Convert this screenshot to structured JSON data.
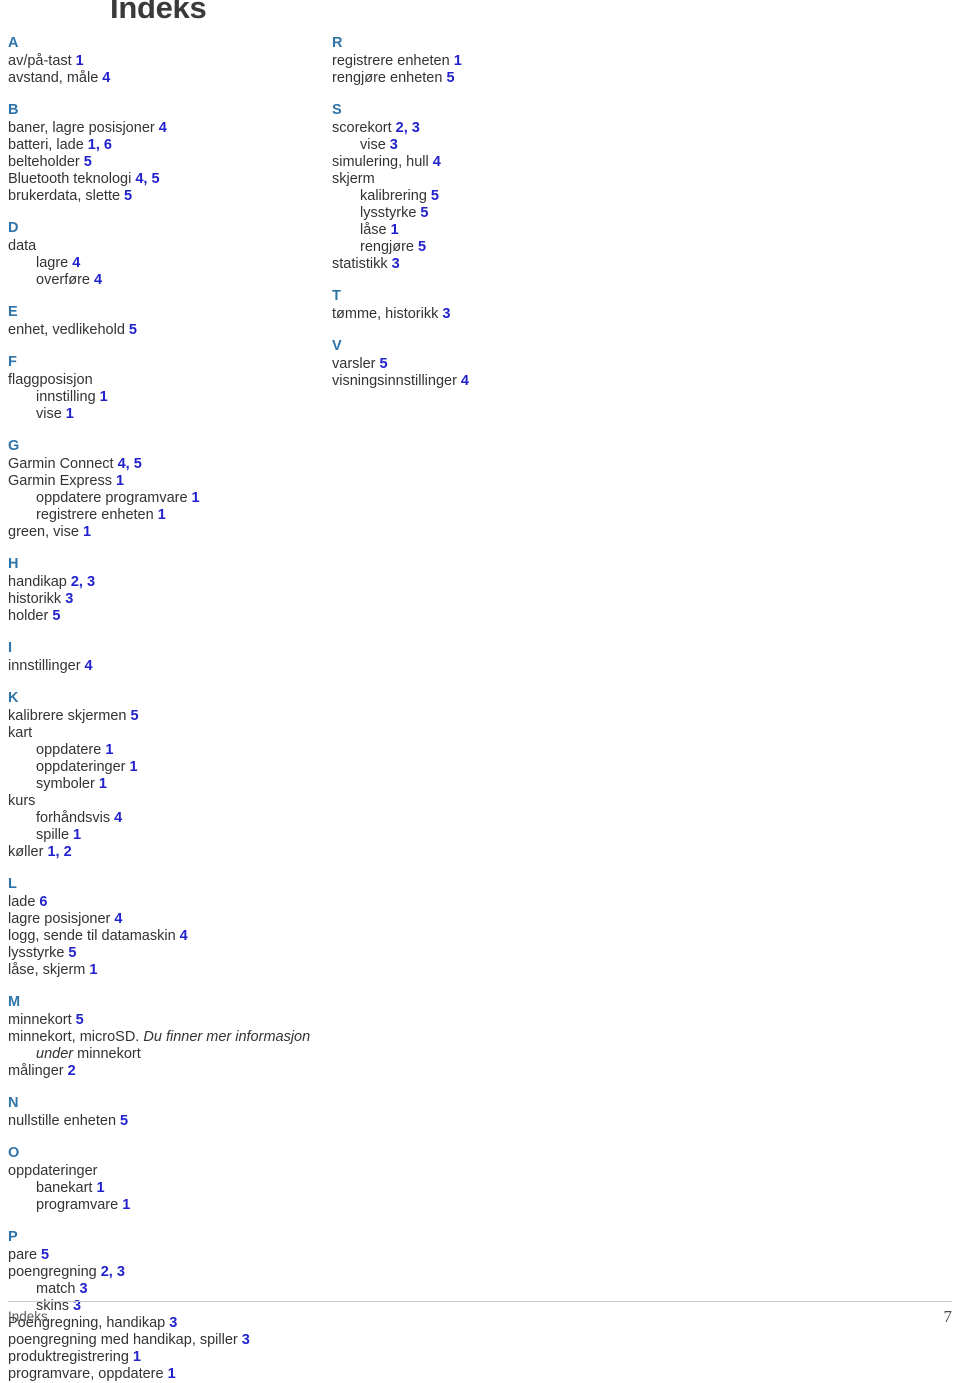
{
  "document": {
    "title": "Indeks",
    "accent_heading_color": "#2e74a8",
    "page_number_color": "#2222cc",
    "body_color": "#333333"
  },
  "footer": {
    "label": "Indeks",
    "page_number": "7"
  },
  "left_column": [
    {
      "letter": "A",
      "entries": [
        {
          "level": 1,
          "text": "av/på-tast",
          "pages": "1"
        },
        {
          "level": 1,
          "text": "avstand, måle",
          "pages": "4"
        }
      ]
    },
    {
      "letter": "B",
      "entries": [
        {
          "level": 1,
          "text": "baner, lagre posisjoner",
          "pages": "4"
        },
        {
          "level": 1,
          "text": "batteri, lade",
          "pages": "1, 6"
        },
        {
          "level": 1,
          "text": "belteholder",
          "pages": "5"
        },
        {
          "level": 1,
          "text": "Bluetooth teknologi",
          "pages": "4, 5"
        },
        {
          "level": 1,
          "text": "brukerdata, slette",
          "pages": "5"
        }
      ]
    },
    {
      "letter": "D",
      "entries": [
        {
          "level": 1,
          "text": "data",
          "pages": ""
        },
        {
          "level": 2,
          "text": "lagre",
          "pages": "4"
        },
        {
          "level": 2,
          "text": "overføre",
          "pages": "4"
        }
      ]
    },
    {
      "letter": "E",
      "entries": [
        {
          "level": 1,
          "text": "enhet, vedlikehold",
          "pages": "5"
        }
      ]
    },
    {
      "letter": "F",
      "entries": [
        {
          "level": 1,
          "text": "flaggposisjon",
          "pages": ""
        },
        {
          "level": 2,
          "text": "innstilling",
          "pages": "1"
        },
        {
          "level": 2,
          "text": "vise",
          "pages": "1"
        }
      ]
    },
    {
      "letter": "G",
      "entries": [
        {
          "level": 1,
          "text": "Garmin Connect",
          "pages": "4, 5"
        },
        {
          "level": 1,
          "text": "Garmin Express",
          "pages": "1"
        },
        {
          "level": 2,
          "text": "oppdatere programvare",
          "pages": "1"
        },
        {
          "level": 2,
          "text": "registrere enheten",
          "pages": "1"
        },
        {
          "level": 1,
          "text": "green, vise",
          "pages": "1"
        }
      ]
    },
    {
      "letter": "H",
      "entries": [
        {
          "level": 1,
          "text": "handikap",
          "pages": "2, 3"
        },
        {
          "level": 1,
          "text": "historikk",
          "pages": "3"
        },
        {
          "level": 1,
          "text": "holder",
          "pages": "5"
        }
      ]
    },
    {
      "letter": "I",
      "entries": [
        {
          "level": 1,
          "text": "innstillinger",
          "pages": "4"
        }
      ]
    },
    {
      "letter": "K",
      "entries": [
        {
          "level": 1,
          "text": "kalibrere skjermen",
          "pages": "5"
        },
        {
          "level": 1,
          "text": "kart",
          "pages": ""
        },
        {
          "level": 2,
          "text": "oppdatere",
          "pages": "1"
        },
        {
          "level": 2,
          "text": "oppdateringer",
          "pages": "1"
        },
        {
          "level": 2,
          "text": "symboler",
          "pages": "1"
        },
        {
          "level": 1,
          "text": "kurs",
          "pages": ""
        },
        {
          "level": 2,
          "text": "forhåndsvis",
          "pages": "4"
        },
        {
          "level": 2,
          "text": "spille",
          "pages": "1"
        },
        {
          "level": 1,
          "text": "køller",
          "pages": "1, 2"
        }
      ]
    },
    {
      "letter": "L",
      "entries": [
        {
          "level": 1,
          "text": "lade",
          "pages": "6"
        },
        {
          "level": 1,
          "text": "lagre posisjoner",
          "pages": "4"
        },
        {
          "level": 1,
          "text": "logg, sende til datamaskin",
          "pages": "4"
        },
        {
          "level": 1,
          "text": "lysstyrke",
          "pages": "5"
        },
        {
          "level": 1,
          "text": "låse, skjerm",
          "pages": "1"
        }
      ]
    },
    {
      "letter": "M",
      "entries": [
        {
          "level": 1,
          "text": "minnekort",
          "pages": "5"
        },
        {
          "level": 1,
          "text": "minnekort, microSD. ",
          "italic": "Du finner mer informasjon under",
          "text_after": " minnekort",
          "pages": "",
          "crossref": true
        },
        {
          "level": 1,
          "text": "målinger",
          "pages": "2"
        }
      ]
    },
    {
      "letter": "N",
      "entries": [
        {
          "level": 1,
          "text": "nullstille enheten",
          "pages": "5"
        }
      ]
    },
    {
      "letter": "O",
      "entries": [
        {
          "level": 1,
          "text": "oppdateringer",
          "pages": ""
        },
        {
          "level": 2,
          "text": "banekart",
          "pages": "1"
        },
        {
          "level": 2,
          "text": "programvare",
          "pages": "1"
        }
      ]
    },
    {
      "letter": "P",
      "entries": [
        {
          "level": 1,
          "text": "pare",
          "pages": "5"
        },
        {
          "level": 1,
          "text": "poengregning",
          "pages": "2, 3"
        },
        {
          "level": 2,
          "text": "match",
          "pages": "3"
        },
        {
          "level": 2,
          "text": "skins",
          "pages": "3"
        },
        {
          "level": 1,
          "text": "Poengregning, handikap",
          "pages": "3"
        },
        {
          "level": 1,
          "text": "poengregning med handikap, spiller",
          "pages": "3"
        },
        {
          "level": 1,
          "text": "produktregistrering",
          "pages": "1"
        },
        {
          "level": 1,
          "text": "programvare, oppdatere",
          "pages": "1"
        }
      ]
    }
  ],
  "right_column": [
    {
      "letter": "R",
      "entries": [
        {
          "level": 1,
          "text": "registrere enheten",
          "pages": "1"
        },
        {
          "level": 1,
          "text": "rengjøre enheten",
          "pages": "5"
        }
      ]
    },
    {
      "letter": "S",
      "entries": [
        {
          "level": 1,
          "text": "scorekort",
          "pages": "2, 3"
        },
        {
          "level": 2,
          "text": "vise",
          "pages": "3"
        },
        {
          "level": 1,
          "text": "simulering, hull",
          "pages": "4"
        },
        {
          "level": 1,
          "text": "skjerm",
          "pages": ""
        },
        {
          "level": 2,
          "text": "kalibrering",
          "pages": "5"
        },
        {
          "level": 2,
          "text": "lysstyrke",
          "pages": "5"
        },
        {
          "level": 2,
          "text": "låse",
          "pages": "1"
        },
        {
          "level": 2,
          "text": "rengjøre",
          "pages": "5"
        },
        {
          "level": 1,
          "text": "statistikk",
          "pages": "3"
        }
      ]
    },
    {
      "letter": "T",
      "entries": [
        {
          "level": 1,
          "text": "tømme, historikk",
          "pages": "3"
        }
      ]
    },
    {
      "letter": "V",
      "entries": [
        {
          "level": 1,
          "text": "varsler",
          "pages": "5"
        },
        {
          "level": 1,
          "text": "visningsinnstillinger",
          "pages": "4"
        }
      ]
    }
  ]
}
